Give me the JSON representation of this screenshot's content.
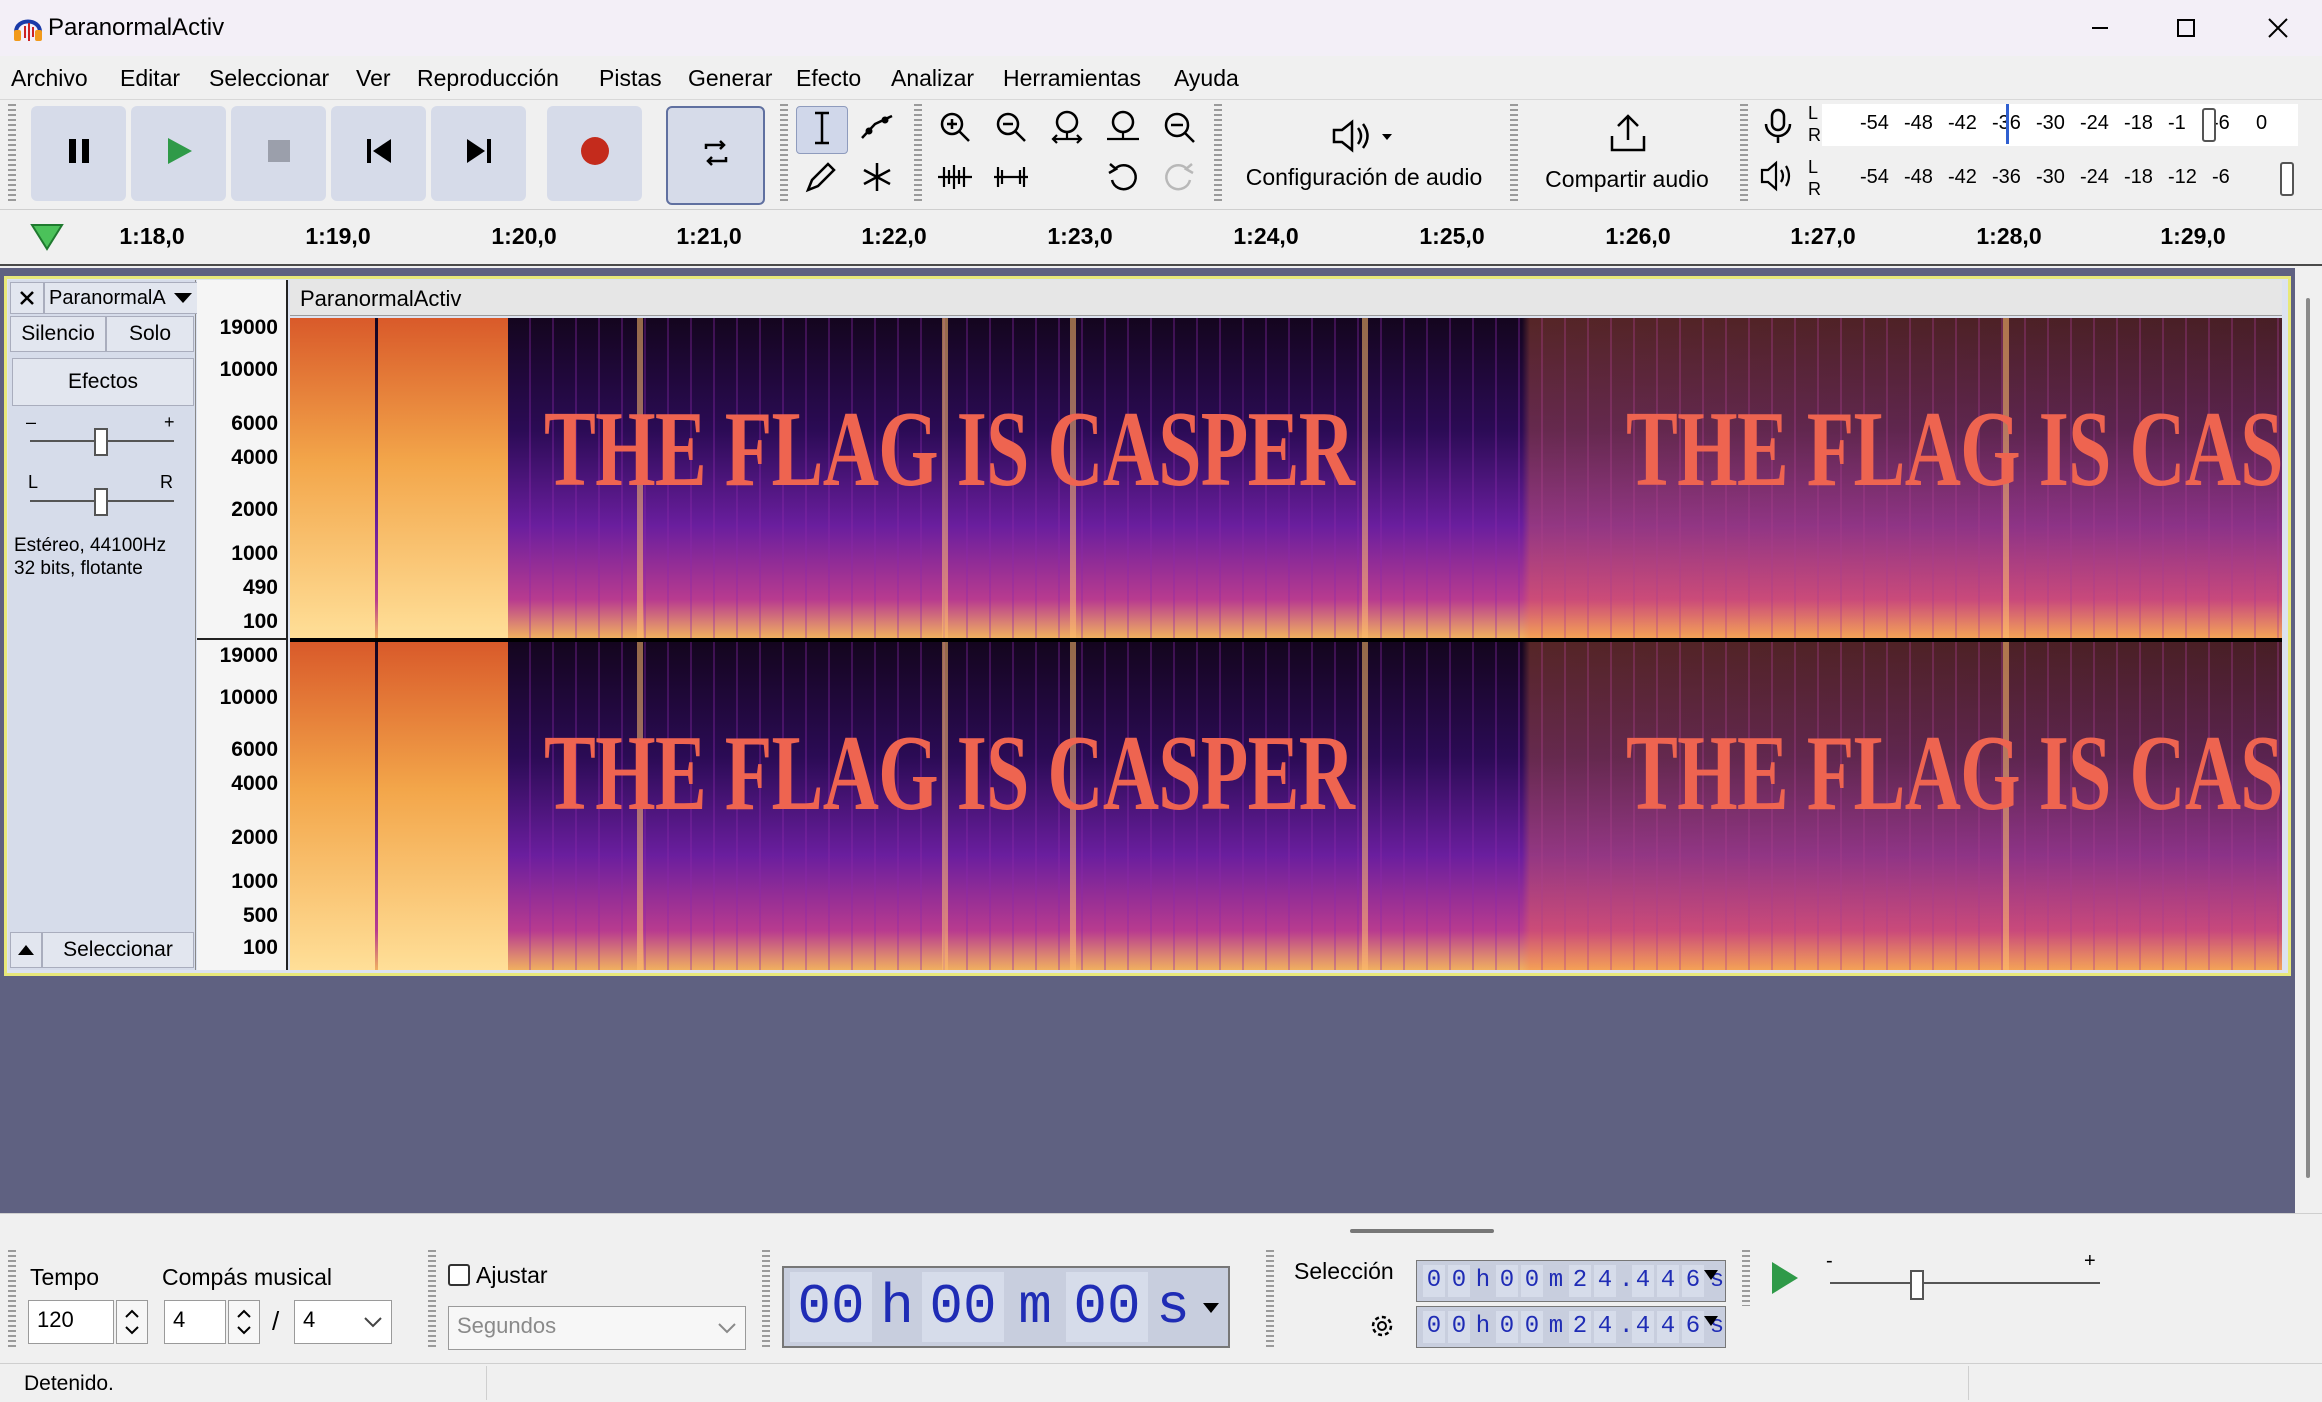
{
  "window": {
    "title": "ParanormalActiv"
  },
  "menu": [
    "Archivo",
    "Editar",
    "Seleccionar",
    "Ver",
    "Reproducción",
    "Pistas",
    "Generar",
    "Efecto",
    "Analizar",
    "Herramientas",
    "Ayuda"
  ],
  "toolbar": {
    "audio_setup_label": "Configuración de audio",
    "share_audio_label": "Compartir audio"
  },
  "meters": {
    "record_channels": [
      "L",
      "R"
    ],
    "play_channels": [
      "L",
      "R"
    ],
    "record_ticks": [
      "-54",
      "-48",
      "-42",
      "-36",
      "-30",
      "-24",
      "-18",
      "-1",
      "-6",
      "0"
    ],
    "play_ticks": [
      "-54",
      "-48",
      "-42",
      "-36",
      "-30",
      "-24",
      "-18",
      "-12",
      "-6"
    ]
  },
  "timeline": {
    "labels": [
      "1:18,0",
      "1:19,0",
      "1:20,0",
      "1:21,0",
      "1:22,0",
      "1:23,0",
      "1:24,0",
      "1:25,0",
      "1:26,0",
      "1:27,0",
      "1:28,0",
      "1:29,0"
    ]
  },
  "track": {
    "name_dropdown": "ParanormalA",
    "name": "ParanormalActiv",
    "mute_label": "Silencio",
    "solo_label": "Solo",
    "effects_label": "Efectos",
    "gain_minus": "–",
    "gain_plus": "+",
    "pan_left": "L",
    "pan_right": "R",
    "info_line1": "Estéreo, 44100Hz",
    "info_line2": "32 bits, flotante",
    "select_label": "Seleccionar",
    "ruler_top": [
      "19000",
      "10000",
      "6000",
      "4000",
      "2000",
      "1000",
      "490",
      "100"
    ],
    "ruler_bottom": [
      "19000",
      "10000",
      "6000",
      "4000",
      "2000",
      "1000",
      "500",
      "100"
    ],
    "spectrogram_text": "THE FLAG IS CASPER",
    "spectrogram_text_clipped": "THE FLAG IS CAS"
  },
  "bottom": {
    "tempo_label": "Tempo",
    "tempo_value": "120",
    "time_sig_label": "Compás musical",
    "time_sig_num": "4",
    "time_sig_sep": "/",
    "time_sig_den": "4",
    "snap_label": "Ajustar",
    "snap_unit": "Segundos",
    "time_display": {
      "h": "00",
      "h_unit": "h",
      "m": "00",
      "m_unit": "m",
      "s": "00",
      "s_unit": "s"
    },
    "selection_label": "Selección",
    "selection_start": [
      "0",
      "0",
      "h",
      "0",
      "0",
      "m",
      "2",
      "4",
      ".",
      "4",
      "4",
      "6",
      "s"
    ],
    "selection_end": [
      "0",
      "0",
      "h",
      "0",
      "0",
      "m",
      "2",
      "4",
      ".",
      "4",
      "4",
      "6",
      "s"
    ],
    "speed_minus": "-",
    "speed_plus": "+"
  },
  "status": {
    "text": "Detenido."
  },
  "colors": {
    "accent_play": "#2f9a48",
    "record": "#c42b1c",
    "digits": "#1f2cb5",
    "track_border": "#e8e87a"
  }
}
